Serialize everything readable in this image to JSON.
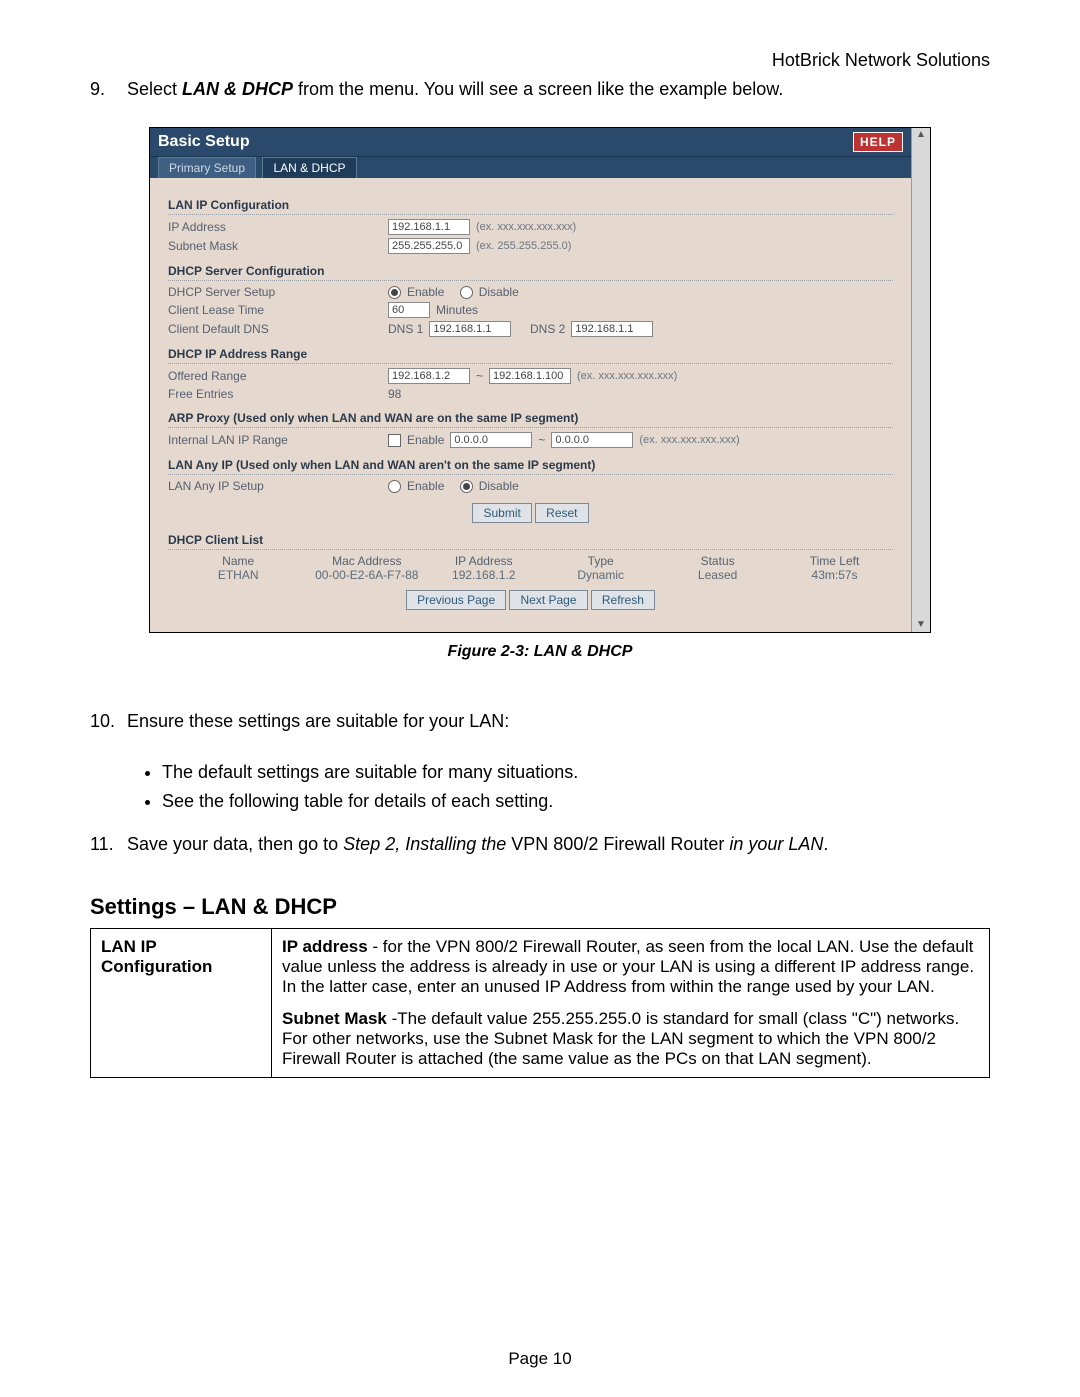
{
  "header_right": "HotBrick Network Solutions",
  "step9": {
    "num": "9.",
    "pre": "Select ",
    "bold": "LAN & DHCP",
    "post": " from the menu. You will see a screen like the example below."
  },
  "shot": {
    "title": "Basic Setup",
    "help": "HELP",
    "tabs": {
      "primary": "Primary Setup",
      "lan": "LAN & DHCP"
    },
    "lan_cfg": {
      "title": "LAN IP Configuration",
      "ip_lbl": "IP Address",
      "ip_val": "192.168.1.1",
      "ip_hint": "(ex. xxx.xxx.xxx.xxx)",
      "mask_lbl": "Subnet Mask",
      "mask_val": "255.255.255.0",
      "mask_hint": "(ex. 255.255.255.0)"
    },
    "dhcp_srv": {
      "title": "DHCP Server Configuration",
      "setup_lbl": "DHCP Server Setup",
      "enable": "Enable",
      "disable": "Disable",
      "lease_lbl": "Client Lease Time",
      "lease_val": "60",
      "lease_unit": "Minutes",
      "dns_lbl": "Client Default DNS",
      "dns1_lbl": "DNS 1",
      "dns1_val": "192.168.1.1",
      "dns2_lbl": "DNS 2",
      "dns2_val": "192.168.1.1"
    },
    "range": {
      "title": "DHCP IP Address Range",
      "off_lbl": "Offered Range",
      "from": "192.168.1.2",
      "tilde": "~",
      "to": "192.168.1.100",
      "off_hint": "(ex. xxx.xxx.xxx.xxx)",
      "free_lbl": "Free Entries",
      "free_val": "98"
    },
    "arp": {
      "title": "ARP Proxy (Used only when LAN and WAN are on the same IP segment)",
      "lbl": "Internal LAN IP Range",
      "enable": "Enable",
      "from": "0.0.0.0",
      "tilde": "~",
      "to": "0.0.0.0",
      "hint": "(ex. xxx.xxx.xxx.xxx)"
    },
    "anyip": {
      "title": "LAN Any IP (Used only when LAN and WAN aren't on the same IP segment)",
      "lbl": "LAN Any IP Setup",
      "enable": "Enable",
      "disable": "Disable"
    },
    "submit": "Submit",
    "reset": "Reset",
    "clients": {
      "title": "DHCP Client List",
      "cols": {
        "name": "Name",
        "mac": "Mac Address",
        "ip": "IP Address",
        "type": "Type",
        "status": "Status",
        "time": "Time Left"
      },
      "row": {
        "name": "ETHAN",
        "mac": "00-00-E2-6A-F7-88",
        "ip": "192.168.1.2",
        "type": "Dynamic",
        "status": "Leased",
        "time": "43m:57s"
      }
    },
    "nav": {
      "prev": "Previous Page",
      "next": "Next Page",
      "refresh": "Refresh"
    }
  },
  "caption": "Figure 2-3: LAN & DHCP",
  "step10": {
    "num": "10.",
    "text": "Ensure these settings are suitable for your LAN:",
    "b1": "The default settings are suitable for many situations.",
    "b2": "See the following table for details of each setting."
  },
  "step11": {
    "num": "11.",
    "pre": "Save your data, then go to ",
    "it1": "Step 2, Installing the",
    "mid": " VPN 800/2 Firewall Router ",
    "it2": "in your LAN",
    "post": "."
  },
  "settings_heading": "Settings – LAN & DHCP",
  "table": {
    "r1_th": "LAN IP Configuration",
    "r1a_b": "IP address",
    "r1a": " - for the VPN 800/2 Firewall Router, as seen from the local LAN. Use the default value unless the address is already in use or your LAN is using a different IP address range. In the latter case, enter an unused IP Address from within the range used by your LAN.",
    "r1b_b": "Subnet Mask",
    "r1b": " -The default value 255.255.255.0 is standard for small (class \"C\") networks. For other networks, use the Subnet Mask for the LAN segment to which the VPN 800/2 Firewall Router is attached (the same value as the PCs on that LAN segment)."
  },
  "footer": "Page 10"
}
